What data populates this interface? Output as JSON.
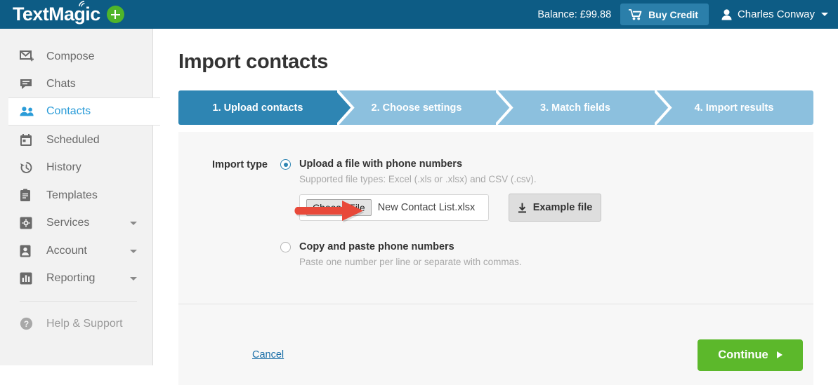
{
  "header": {
    "logo_text": "TextMagic",
    "logo_signal_icon": "signal-waves-icon",
    "logo_plus_icon": "plus-circle-icon",
    "balance_label": "Balance: £99.88",
    "buy_credit_label": "Buy Credit",
    "buy_credit_icon": "shopping-cart-icon",
    "user_name": "Charles Conway",
    "user_icon": "person-icon",
    "user_caret_icon": "chevron-down-icon",
    "bar_color": "#0d5c85",
    "buy_credit_color": "#2b7faa"
  },
  "sidebar": {
    "items": [
      {
        "label": "Compose",
        "icon": "envelope-plus-icon",
        "active": false,
        "has_caret": false
      },
      {
        "label": "Chats",
        "icon": "chat-bubble-icon",
        "active": false,
        "has_caret": false
      },
      {
        "label": "Contacts",
        "icon": "people-icon",
        "active": true,
        "has_caret": false
      },
      {
        "label": "Scheduled",
        "icon": "calendar-icon",
        "active": false,
        "has_caret": false
      },
      {
        "label": "History",
        "icon": "clock-history-icon",
        "active": false,
        "has_caret": false
      },
      {
        "label": "Templates",
        "icon": "clipboard-icon",
        "active": false,
        "has_caret": false
      },
      {
        "label": "Services",
        "icon": "gear-icon",
        "active": false,
        "has_caret": true
      },
      {
        "label": "Account",
        "icon": "user-badge-icon",
        "active": false,
        "has_caret": true
      },
      {
        "label": "Reporting",
        "icon": "bar-chart-icon",
        "active": false,
        "has_caret": true
      }
    ],
    "help_item": {
      "label": "Help & Support",
      "icon": "question-circle-icon"
    },
    "active_color": "#2b9cd8",
    "bg_color": "#f2f2f2"
  },
  "main": {
    "page_title": "Import contacts",
    "steps": [
      {
        "label": "1. Upload contacts",
        "active": true
      },
      {
        "label": "2. Choose settings",
        "active": false
      },
      {
        "label": "3. Match fields",
        "active": false
      },
      {
        "label": "4. Import results",
        "active": false
      }
    ],
    "step_active_color": "#2e85b3",
    "step_inactive_color": "#8cc0de",
    "form": {
      "import_type_label": "Import type",
      "option_upload": {
        "label": "Upload a file with phone numbers",
        "help": "Supported file types: Excel (.xls or .xlsx) and CSV (.csv).",
        "selected": true
      },
      "option_paste": {
        "label": "Copy and paste phone numbers",
        "help": "Paste one number per line or separate with commas.",
        "selected": false
      },
      "file_input": {
        "button_label": "Choose File",
        "file_name": "New Contact List.xlsx"
      },
      "example_button": {
        "label": "Example file",
        "icon": "download-icon"
      }
    },
    "footer": {
      "cancel_label": "Cancel",
      "continue_label": "Continue",
      "continue_icon": "arrow-right-triangle-icon",
      "continue_color": "#5cb82b"
    }
  },
  "annotation": {
    "arrow_icon": "red-arrow-right-icon",
    "arrow_color": "#e8493a"
  }
}
